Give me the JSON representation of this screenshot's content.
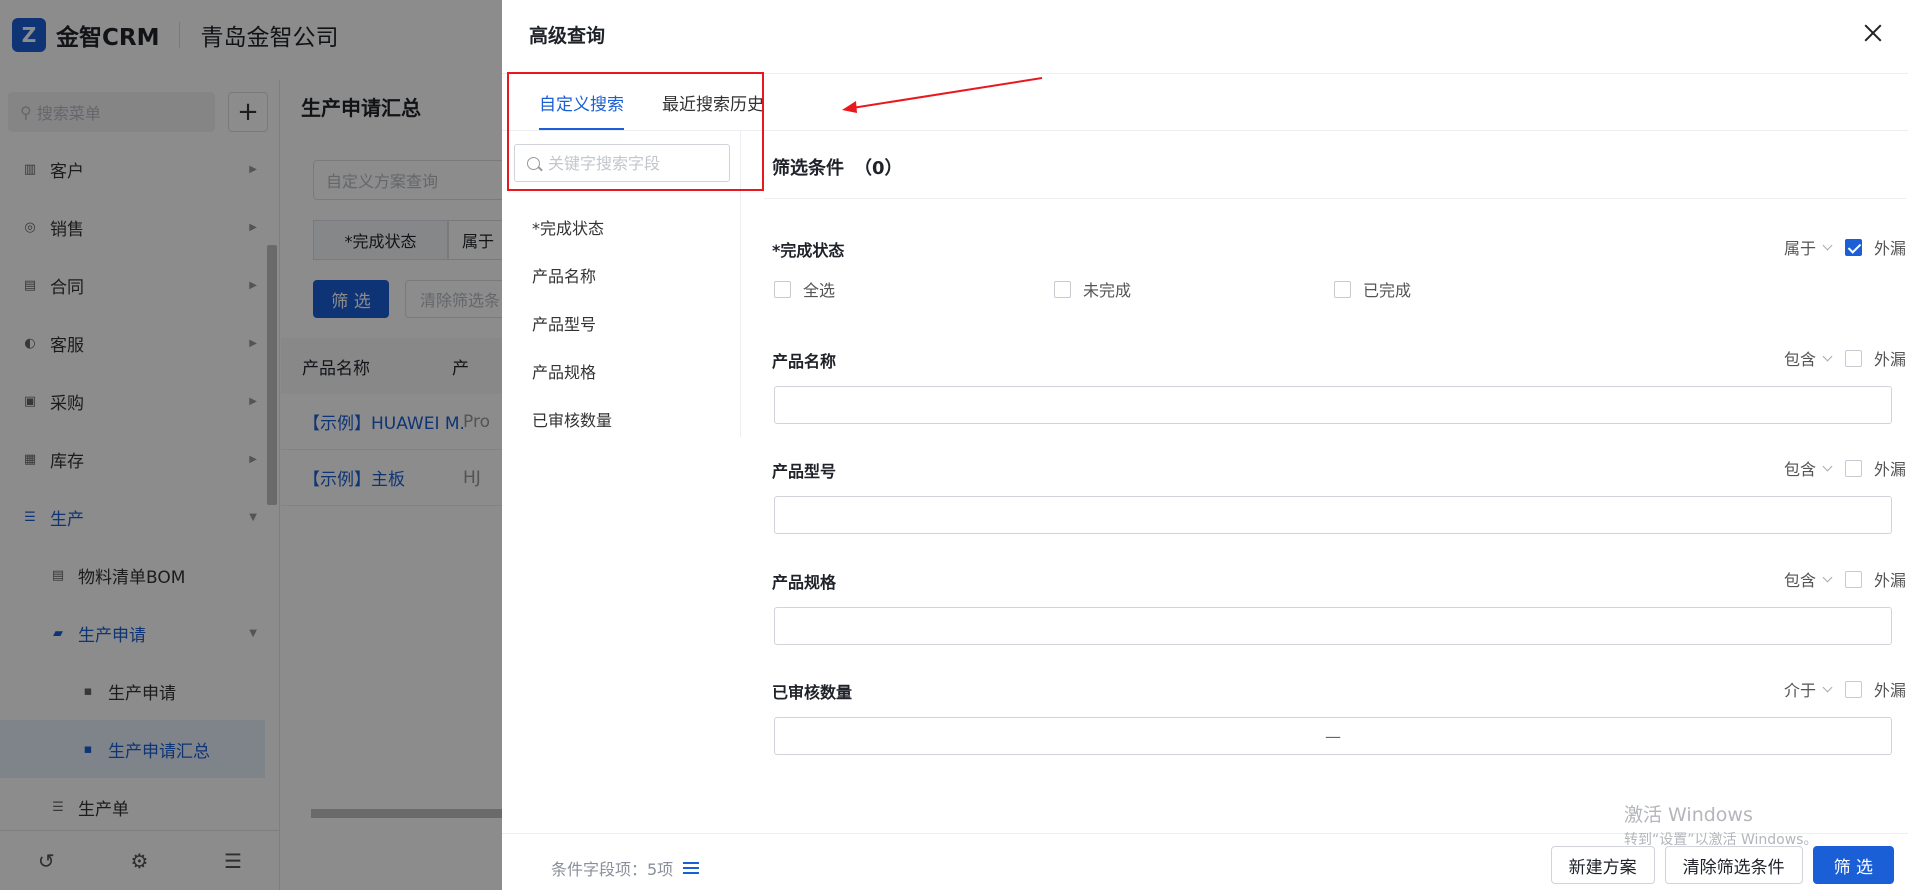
{
  "app": {
    "brand": "金智CRM",
    "company": "青岛金智公司",
    "menu_search_placeholder": "搜索菜单",
    "menu": [
      {
        "label": "客户",
        "icon": "chart-icon"
      },
      {
        "label": "销售",
        "icon": "sales-icon"
      },
      {
        "label": "合同",
        "icon": "contract-icon"
      },
      {
        "label": "客服",
        "icon": "service-icon"
      },
      {
        "label": "采购",
        "icon": "purchase-icon"
      },
      {
        "label": "库存",
        "icon": "warehouse-icon"
      },
      {
        "label": "生产",
        "icon": "production-icon"
      },
      {
        "label": "物料清单BOM",
        "icon": "bom-icon"
      },
      {
        "label": "生产申请",
        "icon": "folder-icon"
      },
      {
        "label": "生产申请",
        "icon": "request-icon"
      },
      {
        "label": "生产申请汇总",
        "icon": "summary-icon"
      },
      {
        "label": "生产单",
        "icon": "order-icon"
      }
    ]
  },
  "main": {
    "title": "生产申请汇总",
    "scheme_placeholder": "自定义方案查询",
    "chip_field": "*完成状态",
    "chip_op": "属于",
    "filter_btn": "筛 选",
    "clear_btn": "清除筛选条",
    "columns": [
      "产品名称",
      "产"
    ],
    "rows": [
      {
        "name": "【示例】HUAWEI M...",
        "col2": "Pro"
      },
      {
        "name": "【示例】主板",
        "col2": "HJ"
      }
    ]
  },
  "drawer": {
    "title": "高级查询",
    "tabs": [
      "自定义搜索",
      "最近搜索历史"
    ],
    "keyword_placeholder": "关键字搜索字段",
    "fields": [
      "*完成状态",
      "产品名称",
      "产品型号",
      "产品规格",
      "已审核数量"
    ],
    "cond_title": "筛选条件",
    "cond_count": "（0）",
    "exclude_label": "外漏",
    "conditions": {
      "status": {
        "label": "*完成状态",
        "op": "属于",
        "exclude_checked": true,
        "options": [
          "全选",
          "未完成",
          "已完成"
        ]
      },
      "name": {
        "label": "产品名称",
        "op": "包含",
        "exclude_checked": false,
        "value": ""
      },
      "model": {
        "label": "产品型号",
        "op": "包含",
        "exclude_checked": false,
        "value": ""
      },
      "spec": {
        "label": "产品规格",
        "op": "包含",
        "exclude_checked": false,
        "value": ""
      },
      "audited": {
        "label": "已审核数量",
        "op": "介于",
        "exclude_checked": false,
        "range_sep": "—"
      }
    },
    "footer_count": "条件字段项：5项",
    "buttons": {
      "new_scheme": "新建方案",
      "clear": "清除筛选条件",
      "filter": "筛 选"
    }
  },
  "watermark": {
    "line1": "激活 Windows",
    "line2": "转到“设置”以激活 Windows。"
  },
  "colors": {
    "primary": "#1a5fd6",
    "annotation": "#e8191e"
  }
}
